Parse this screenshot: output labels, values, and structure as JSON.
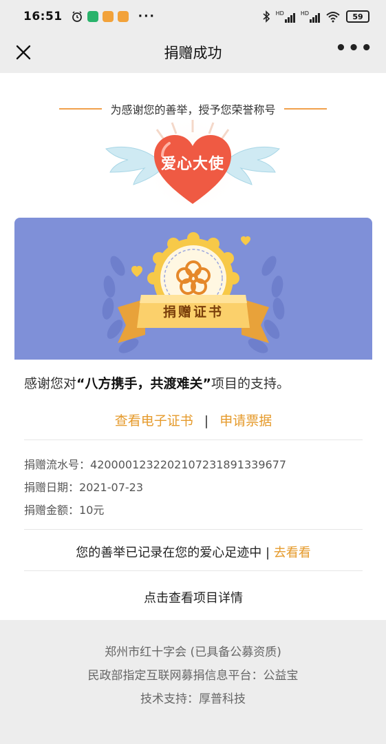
{
  "status_bar": {
    "time": "16:51",
    "battery": "59",
    "net_1": "HD",
    "net_2": "HD"
  },
  "nav": {
    "title": "捐赠成功"
  },
  "honor": {
    "caption": "为感谢您的善举，授予您荣誉称号",
    "badge": "爱心大使"
  },
  "certificate": {
    "label": "捐赠证书",
    "thanks_prefix": "感谢您对",
    "project_name": "“八方携手，共渡难关”",
    "thanks_suffix": "项目的支持。",
    "view_certificate": "查看电子证书",
    "separator": "|",
    "request_receipt": "申请票据",
    "serial_label": "捐赠流水号：",
    "serial_value": "4200001232202107231891339677",
    "date_label": "捐赠日期：",
    "date_value": "2021-07-23",
    "amount_label": "捐赠金额：",
    "amount_value": "10元",
    "footprint_text": "您的善举已记录在您的爱心足迹中 |",
    "footprint_link": "去看看",
    "detail_link": "点击查看项目详情"
  },
  "footer": {
    "line1": "郑州市红十字会 (已具备公募资质)",
    "line2": "民政部指定互联网募捐信息平台：公益宝",
    "line3": "技术支持：厚普科技"
  },
  "colors": {
    "accent": "#e59a2b",
    "banner": "#7f90d8",
    "heart": "#ef5a43"
  }
}
